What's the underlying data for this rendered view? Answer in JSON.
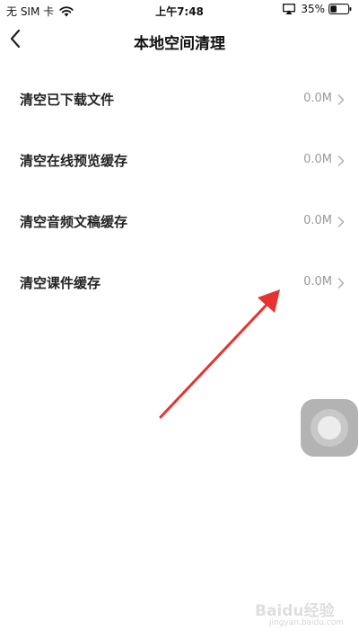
{
  "status_bar": {
    "carrier": "无 SIM 卡",
    "time": "上午7:48",
    "battery": "35%"
  },
  "nav": {
    "title": "本地空间清理"
  },
  "items": [
    {
      "label": "清空已下载文件",
      "value": "0.0M"
    },
    {
      "label": "清空在线预览缓存",
      "value": "0.0M"
    },
    {
      "label": "清空音频文稿缓存",
      "value": "0.0M"
    },
    {
      "label": "清空课件缓存",
      "value": "0.0M"
    }
  ],
  "watermark": {
    "text": "Baidu经验",
    "sub": "jingyan.baidu.com"
  },
  "colors": {
    "annotation_arrow": "#e8322f",
    "value_text": "#999999",
    "label_text": "#222222"
  },
  "icons": {
    "back": "back-arrow-icon",
    "chevron": "chevron-right-icon",
    "wifi": "wifi-icon",
    "airplay": "airplay-icon",
    "battery": "battery-icon"
  }
}
